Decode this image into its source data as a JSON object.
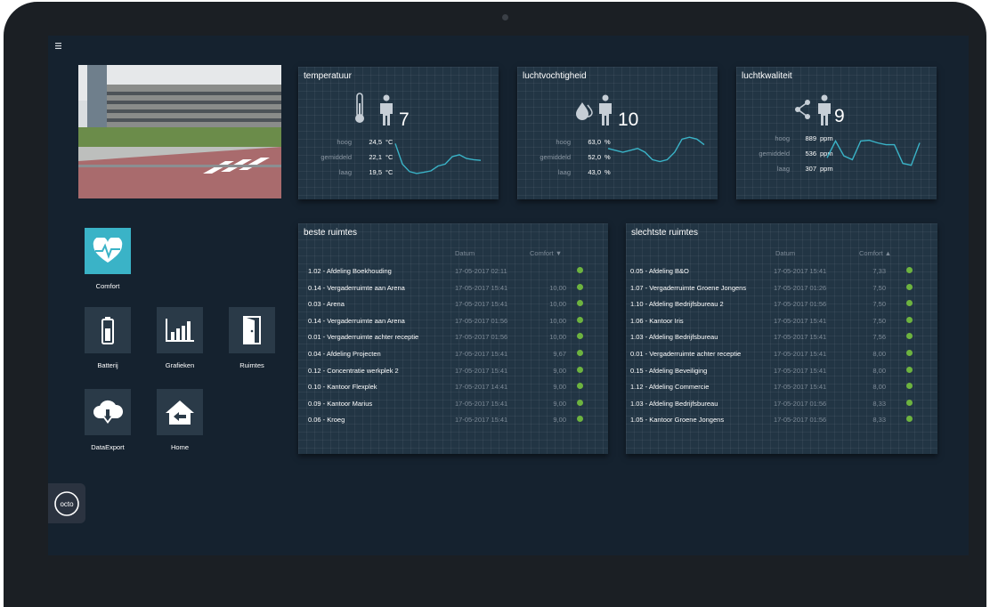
{
  "menu_icon": "hamburger-icon",
  "metrics": [
    {
      "title": "temperatuur",
      "icon": "thermometer-icon",
      "person_icon": "person-icon",
      "value": "7",
      "rows": [
        {
          "label": "hoog",
          "value": "24,5",
          "unit": "°C"
        },
        {
          "label": "gemiddeld",
          "value": "22,1",
          "unit": "°C"
        },
        {
          "label": "laag",
          "value": "19,5",
          "unit": "°C"
        }
      ],
      "trend": [
        0.85,
        0.3,
        0.1,
        0.05,
        0.08,
        0.12,
        0.25,
        0.3,
        0.5,
        0.55,
        0.45,
        0.42,
        0.4
      ]
    },
    {
      "title": "luchtvochtigheid",
      "icon": "droplets-icon",
      "person_icon": "person-icon",
      "value": "10",
      "rows": [
        {
          "label": "hoog",
          "value": "63,0",
          "unit": "%"
        },
        {
          "label": "gemiddeld",
          "value": "52,0",
          "unit": "%"
        },
        {
          "label": "laag",
          "value": "43,0",
          "unit": "%"
        }
      ],
      "trend": [
        0.6,
        0.55,
        0.5,
        0.55,
        0.6,
        0.5,
        0.3,
        0.25,
        0.3,
        0.5,
        0.85,
        0.9,
        0.85,
        0.7
      ]
    },
    {
      "title": "luchtkwaliteit",
      "icon": "molecule-icon",
      "person_icon": "person-icon",
      "value": "9",
      "rows": [
        {
          "label": "hoog",
          "value": "889",
          "unit": "ppm"
        },
        {
          "label": "gemiddeld",
          "value": "536",
          "unit": "ppm"
        },
        {
          "label": "laag",
          "value": "307",
          "unit": "ppm"
        }
      ],
      "trend": [
        0.35,
        0.8,
        0.4,
        0.3,
        0.8,
        0.82,
        0.75,
        0.7,
        0.7,
        0.2,
        0.15,
        0.75
      ]
    }
  ],
  "best": {
    "title": "beste ruimtes",
    "col_date": "Datum",
    "col_comfort": "Comfort ▼",
    "rows": [
      {
        "name": "1.02 - Afdeling Boekhouding",
        "date": "17-05-2017 02:11",
        "score": ""
      },
      {
        "name": "0.14 - Vergaderruimte aan Arena",
        "date": "17-05-2017 15:41",
        "score": "10,00"
      },
      {
        "name": "0.03 - Arena",
        "date": "17-05-2017 15:41",
        "score": "10,00"
      },
      {
        "name": "0.14 - Vergaderruimte aan Arena",
        "date": "17-05-2017 01:56",
        "score": "10,00"
      },
      {
        "name": "0.01 - Vergaderruimte achter receptie",
        "date": "17-05-2017 01:56",
        "score": "10,00"
      },
      {
        "name": "0.04 - Afdeling Projecten",
        "date": "17-05-2017 15:41",
        "score": "9,67"
      },
      {
        "name": "0.12 - Concentratie werkplek 2",
        "date": "17-05-2017 15:41",
        "score": "9,00"
      },
      {
        "name": "0.10 - Kantoor Flexplek",
        "date": "17-05-2017 14:41",
        "score": "9,00"
      },
      {
        "name": "0.09 - Kantoor Marius",
        "date": "17-05-2017 15:41",
        "score": "9,00"
      },
      {
        "name": "0.06 - Kroeg",
        "date": "17-05-2017 15:41",
        "score": "9,00"
      }
    ]
  },
  "worst": {
    "title": "slechtste ruimtes",
    "col_date": "Datum",
    "col_comfort": "Comfort ▲",
    "rows": [
      {
        "name": "0.05 - Afdeling B&O",
        "date": "17-05-2017 15:41",
        "score": "7,33"
      },
      {
        "name": "1.07 - Vergaderruimte Groene Jongens",
        "date": "17-05-2017 01:26",
        "score": "7,50"
      },
      {
        "name": "1.10 - Afdeling Bedrijfsbureau 2",
        "date": "17-05-2017 01:56",
        "score": "7,50"
      },
      {
        "name": "1.06 - Kantoor Iris",
        "date": "17-05-2017 15:41",
        "score": "7,50"
      },
      {
        "name": "1.03 - Afdeling Bedrijfsbureau",
        "date": "17-05-2017 15:41",
        "score": "7,56"
      },
      {
        "name": "0.01 - Vergaderruimte achter receptie",
        "date": "17-05-2017 15:41",
        "score": "8,00"
      },
      {
        "name": "0.15 - Afdeling Beveiliging",
        "date": "17-05-2017 15:41",
        "score": "8,00"
      },
      {
        "name": "1.12 - Afdeling Commercie",
        "date": "17-05-2017 15:41",
        "score": "8,00"
      },
      {
        "name": "1.03 - Afdeling Bedrijfsbureau",
        "date": "17-05-2017 01:56",
        "score": "8,33"
      },
      {
        "name": "1.05 - Kantoor Groene Jongens",
        "date": "17-05-2017 01:56",
        "score": "8,33"
      }
    ]
  },
  "nav": [
    {
      "label": "Comfort",
      "icon": "heart-pulse-icon",
      "active": true
    },
    {
      "label": "Batterij",
      "icon": "battery-icon",
      "active": false
    },
    {
      "label": "Grafieken",
      "icon": "bar-chart-icon",
      "active": false
    },
    {
      "label": "Ruimtes",
      "icon": "door-icon",
      "active": false
    },
    {
      "label": "DataExport",
      "icon": "cloud-download-icon",
      "active": false
    },
    {
      "label": "Home",
      "icon": "home-icon",
      "active": false
    }
  ],
  "logo": {
    "text": "octo",
    "icon": "octo-logo-icon"
  },
  "colors": {
    "accent": "#3ab3c7",
    "status_good": "#6db33f",
    "panel": "#223544",
    "background": "#15222f"
  }
}
